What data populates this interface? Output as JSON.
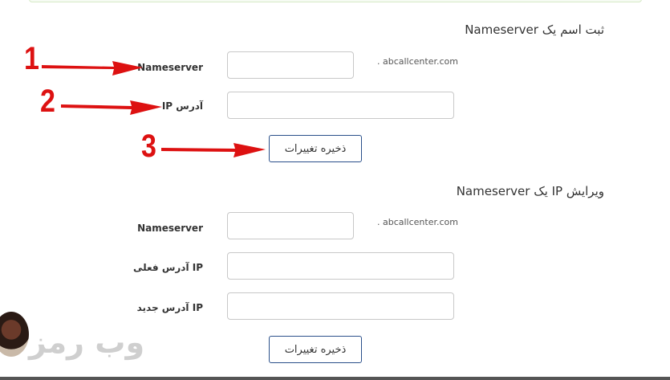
{
  "section1": {
    "title": "ثبت اسم یک Nameserver",
    "nameserver_label": "Nameserver",
    "nameserver_value": "",
    "domain_suffix": ". abcallcenter.com",
    "ip_label": "آدرس IP",
    "ip_value": "",
    "save_label": "ذخیره تغییرات"
  },
  "section2": {
    "title": "ویرایش IP یک Nameserver",
    "nameserver_label": "Nameserver",
    "nameserver_value": "",
    "domain_suffix": ". abcallcenter.com",
    "current_ip_label": "IP آدرس فعلی",
    "current_ip_value": "",
    "new_ip_label": "IP آدرس جدید",
    "new_ip_value": "",
    "save_label": "ذخیره تغییرات"
  },
  "annotations": {
    "step1": "1",
    "step2": "2",
    "step3": "3",
    "arrow_color": "#dd1111"
  },
  "watermark": {
    "text": "وب رمز",
    "avatar": "avatar-photo"
  }
}
